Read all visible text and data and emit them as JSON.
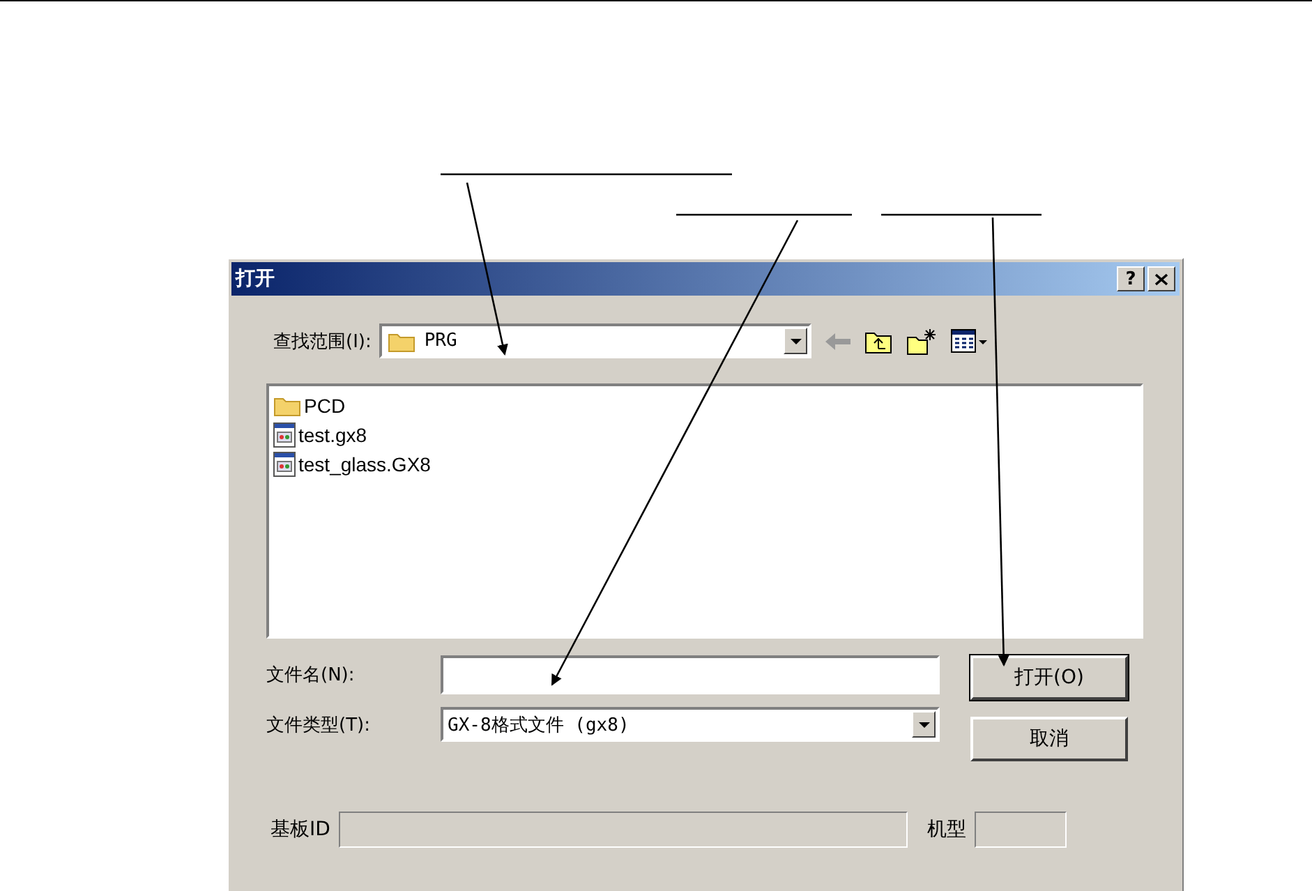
{
  "window": {
    "title": "打开",
    "help": "?"
  },
  "look_in": {
    "label": "查找范围(I):",
    "value": "PRG"
  },
  "files": [
    {
      "name": "PCD",
      "kind": "folder"
    },
    {
      "name": "test.gx8",
      "kind": "file"
    },
    {
      "name": "test_glass.GX8",
      "kind": "file"
    }
  ],
  "file_name": {
    "label": "文件名(N):"
  },
  "file_type": {
    "label": "文件类型(T):",
    "value": "GX-8格式文件 (gx8)"
  },
  "buttons": [
    "打开(O)",
    "取消"
  ],
  "board_id": {
    "label": "基板ID"
  },
  "model": {
    "label": "机型"
  }
}
